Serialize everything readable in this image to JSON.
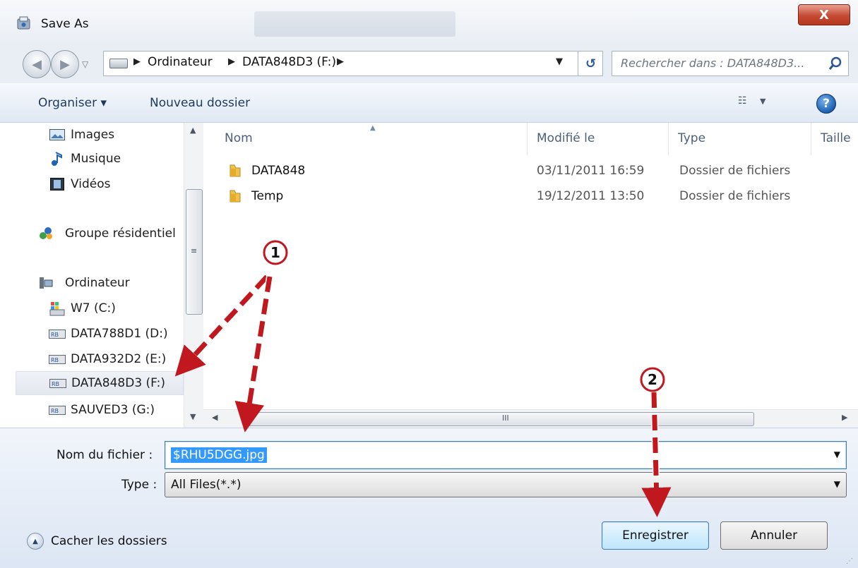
{
  "window": {
    "title": "Save As",
    "close_label": "X"
  },
  "address": {
    "crumbs": [
      "Ordinateur",
      "DATA848D3 (F:)"
    ],
    "search_placeholder": "Rechercher dans : DATA848D3..."
  },
  "toolbar": {
    "organiser_label": "Organiser ▾",
    "new_folder_label": "Nouveau dossier",
    "help_label": "?"
  },
  "nav": {
    "items": [
      {
        "label": "Images",
        "icon": "images-icon"
      },
      {
        "label": "Musique",
        "icon": "music-icon"
      },
      {
        "label": "Vidéos",
        "icon": "videos-icon"
      },
      {
        "label": "Groupe résidentiel",
        "icon": "homegroup-icon"
      },
      {
        "label": "Ordinateur",
        "icon": "computer-icon"
      },
      {
        "label": "W7 (C:)",
        "icon": "system-drive-icon"
      },
      {
        "label": "DATA788D1 (D:)",
        "icon": "drive-icon"
      },
      {
        "label": "DATA932D2 (E:)",
        "icon": "drive-icon"
      },
      {
        "label": "DATA848D3 (F:)",
        "icon": "drive-icon",
        "selected": true
      },
      {
        "label": "SAUVED3 (G:)",
        "icon": "drive-icon"
      }
    ]
  },
  "files": {
    "columns": [
      "Nom",
      "Modifié le",
      "Type",
      "Taille"
    ],
    "rows": [
      {
        "name": "DATA848",
        "modified": "03/11/2011 16:59",
        "type": "Dossier de fichiers"
      },
      {
        "name": "Temp",
        "modified": "19/12/2011 13:50",
        "type": "Dossier de fichiers"
      }
    ]
  },
  "form": {
    "filename_label": "Nom du fichier :",
    "filename_value": "$RHU5DGG.jpg",
    "type_label": "Type :",
    "type_value": "All Files(*.*)"
  },
  "footer": {
    "hide_folders_label": "Cacher les dossiers",
    "save_label": "Enregistrer",
    "cancel_label": "Annuler"
  },
  "annotations": {
    "marker1": "1",
    "marker2": "2",
    "arrow_color": "#c0181e"
  }
}
